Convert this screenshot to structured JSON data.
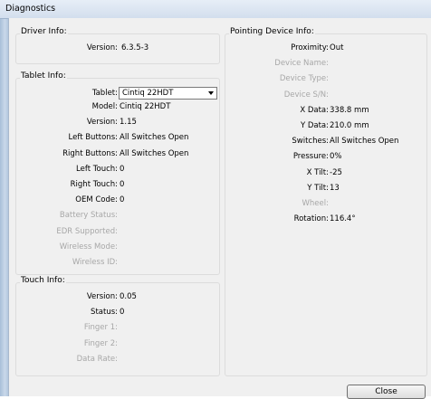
{
  "window": {
    "title": "Diagnostics"
  },
  "driver": {
    "label": "Driver Info:",
    "version_label": "Version:",
    "version_value": "6.3.5-3"
  },
  "tablet": {
    "label": "Tablet Info:",
    "selector": {
      "label": "Tablet:",
      "selected": "Cintiq 22HDT"
    },
    "rows": [
      {
        "label": "Model:",
        "value": "Cintiq 22HDT",
        "disabled": false
      },
      {
        "label": "Version:",
        "value": "1.15",
        "disabled": false
      },
      {
        "label": "Left Buttons:",
        "value": "All Switches Open",
        "disabled": false
      },
      {
        "label": "Right Buttons:",
        "value": "All Switches Open",
        "disabled": false
      },
      {
        "label": "Left Touch:",
        "value": "0",
        "disabled": false
      },
      {
        "label": "Right Touch:",
        "value": "0",
        "disabled": false
      },
      {
        "label": "OEM Code:",
        "value": "0",
        "disabled": false
      },
      {
        "label": "Battery Status:",
        "value": "",
        "disabled": true
      },
      {
        "label": "EDR Supported:",
        "value": "",
        "disabled": true
      },
      {
        "label": "Wireless Mode:",
        "value": "",
        "disabled": true
      },
      {
        "label": "Wireless ID:",
        "value": "",
        "disabled": true
      }
    ]
  },
  "touch": {
    "label": "Touch Info:",
    "rows": [
      {
        "label": "Version:",
        "value": "0.05",
        "disabled": false
      },
      {
        "label": "Status:",
        "value": "0",
        "disabled": false
      },
      {
        "label": "Finger 1:",
        "value": "",
        "disabled": true
      },
      {
        "label": "Finger 2:",
        "value": "",
        "disabled": true
      },
      {
        "label": "Data Rate:",
        "value": "",
        "disabled": true
      }
    ]
  },
  "pointing": {
    "label": "Pointing Device Info:",
    "rows": [
      {
        "label": "Proximity:",
        "value": "Out",
        "disabled": false
      },
      {
        "label": "Device Name:",
        "value": "",
        "disabled": true
      },
      {
        "label": "Device Type:",
        "value": "",
        "disabled": true
      },
      {
        "label": "Device S/N:",
        "value": "",
        "disabled": true
      },
      {
        "label": "X Data:",
        "value": "338.8 mm",
        "disabled": false
      },
      {
        "label": "Y Data:",
        "value": "210.0 mm",
        "disabled": false
      },
      {
        "label": "Switches:",
        "value": "All Switches Open",
        "disabled": false
      },
      {
        "label": "Pressure:",
        "value": "0%",
        "disabled": false
      },
      {
        "label": "X Tilt:",
        "value": "-25",
        "disabled": false
      },
      {
        "label": "Y Tilt:",
        "value": "13",
        "disabled": false
      },
      {
        "label": "Wheel:",
        "value": "",
        "disabled": true
      },
      {
        "label": "Rotation:",
        "value": "116.4°",
        "disabled": false
      }
    ]
  },
  "buttons": {
    "close": "Close"
  }
}
